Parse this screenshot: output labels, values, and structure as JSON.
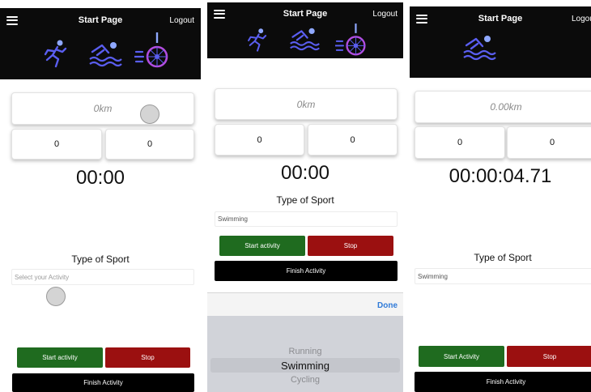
{
  "nav": {
    "title": "Start Page",
    "logout": "Logout"
  },
  "colors": {
    "running": "#5a5ef0",
    "swimming": "#5a5ef0",
    "cycling": "#b14de0",
    "accent_dot": "#8fa8ff",
    "start": "#1f6b1f",
    "stop": "#9b1010",
    "finish": "#000000"
  },
  "screens": [
    {
      "distance": "0km",
      "counter_left": "0",
      "counter_right": "0",
      "timer": "00:00",
      "sport_label": "Type of Sport",
      "sport_placeholder": "Select your Activity",
      "start_label": "Start activity",
      "stop_label": "Stop",
      "finish_label": "Finish Activity"
    },
    {
      "distance": "0km",
      "counter_left": "0",
      "counter_right": "0",
      "timer": "00:00",
      "sport_label": "Type of Sport",
      "sport_value": "Swimming",
      "start_label": "Start activity",
      "stop_label": "Stop",
      "finish_label": "Finish Activity",
      "picker": {
        "done_label": "Done",
        "options": [
          "Running",
          "Swimming",
          "Cycling"
        ],
        "selected": "Swimming"
      }
    },
    {
      "distance": "0.00km",
      "counter_left": "0",
      "counter_right": "0",
      "timer": "00:00:04.71",
      "sport_label": "Type of Sport",
      "sport_value": "Swimming",
      "start_label": "Start Activity",
      "stop_label": "Stop",
      "finish_label": "Finish Activity"
    }
  ]
}
